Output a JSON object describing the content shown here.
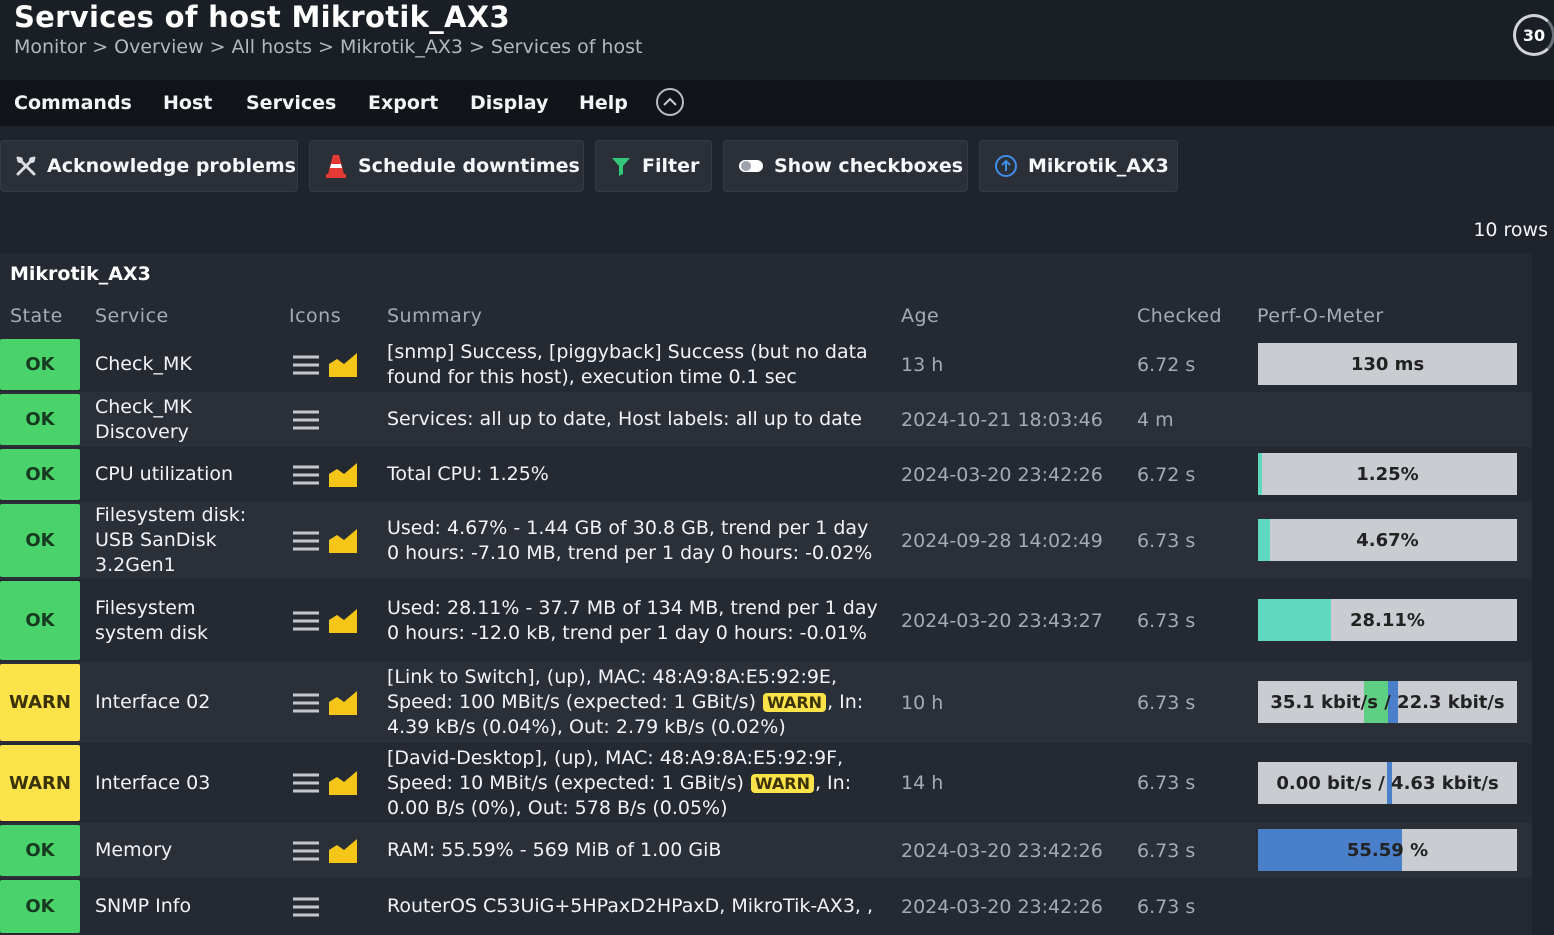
{
  "header": {
    "title": "Services of host Mikrotik_AX3",
    "breadcrumb": [
      "Monitor",
      "Overview",
      "All hosts",
      "Mikrotik_AX3",
      "Services of host"
    ],
    "refresh_seconds": "30"
  },
  "menu": {
    "items": [
      "Commands",
      "Host",
      "Services",
      "Export",
      "Display",
      "Help"
    ]
  },
  "toolbar": {
    "acknowledge": "Acknowledge problems",
    "schedule": "Schedule downtimes",
    "filter": "Filter",
    "checkboxes": "Show checkboxes",
    "host": "Mikrotik_AX3"
  },
  "table": {
    "rows_count": "10 rows",
    "host_name": "Mikrotik_AX3",
    "columns": [
      "State",
      "Service",
      "Icons",
      "Summary",
      "Age",
      "Checked",
      "Perf-O-Meter"
    ],
    "rows": [
      {
        "state": "OK",
        "service": "Check_MK",
        "summary": "[snmp] Success, [piggyback] Success (but no data found for this host), execution time 0.1 sec",
        "age": "13 h",
        "checked": "6.72 s",
        "perf_label": "130 ms",
        "perf_fraction": 0
      },
      {
        "state": "OK",
        "service": "Check_MK Discovery",
        "summary": "Services: all up to date, Host labels: all up to date",
        "age": "2024-10-21 18:03:46",
        "checked": "4 m",
        "perf_label": ""
      },
      {
        "state": "OK",
        "service": "CPU utilization",
        "summary": "Total CPU: 1.25%",
        "age": "2024-03-20 23:42:26",
        "checked": "6.72 s",
        "perf_label": "1.25%",
        "perf_fraction": 0.0125
      },
      {
        "state": "OK",
        "service": "Filesystem disk: USB SanDisk 3.2Gen1",
        "summary": "Used: 4.67% - 1.44 GB of 30.8 GB, trend per 1 day 0 hours: -7.10 MB, trend per 1 day 0 hours: -0.02%",
        "age": "2024-09-28 14:02:49",
        "checked": "6.73 s",
        "perf_label": "4.67%",
        "perf_fraction": 0.0467
      },
      {
        "state": "OK",
        "service": "Filesystem system disk",
        "summary": "Used: 28.11% - 37.7 MB of 134 MB, trend per 1 day 0 hours: -12.0 kB, trend per 1 day 0 hours: -0.01%",
        "age": "2024-03-20 23:43:27",
        "checked": "6.73 s",
        "perf_label": "28.11%",
        "perf_fraction": 0.2811
      },
      {
        "state": "WARN",
        "service": "Interface 02",
        "summary_pre": "[Link to Switch], (up), MAC: 48:A9:8A:E5:92:9E, Speed: 100 MBit/s (expected: 1 GBit/s)",
        "summary_badge": "WARN",
        "summary_post": ", In: 4.39 kB/s (0.04%), Out: 2.79 kB/s (0.02%)",
        "age": "10 h",
        "checked": "6.73 s",
        "perf_label": "35.1 kbit/s / 22.3 kbit/s"
      },
      {
        "state": "WARN",
        "service": "Interface 03",
        "summary_pre": "[David-Desktop], (up), MAC: 48:A9:8A:E5:92:9F, Speed: 10 MBit/s (expected: 1 GBit/s)",
        "summary_badge": "WARN",
        "summary_post": ", In: 0.00 B/s (0%), Out: 578 B/s (0.05%)",
        "age": "14 h",
        "checked": "6.73 s",
        "perf_label": "0.00 bit/s / 4.63 kbit/s"
      },
      {
        "state": "OK",
        "service": "Memory",
        "summary": "RAM: 55.59% - 569 MiB of 1.00 GiB",
        "age": "2024-03-20 23:42:26",
        "checked": "6.73 s",
        "perf_label": "55.59 %",
        "perf_fraction": 0.5559
      },
      {
        "state": "OK",
        "service": "SNMP Info",
        "summary": "RouterOS C53UiG+5HPaxD2HPaxD, MikroTik-AX3, ,",
        "age": "2024-03-20 23:42:26",
        "checked": "6.73 s",
        "perf_label": ""
      }
    ]
  },
  "colors": {
    "ok": "#4ad36b",
    "warn": "#fde34a",
    "perf_green": "#5fd8c0",
    "perf_blue": "#4a7fc9"
  }
}
